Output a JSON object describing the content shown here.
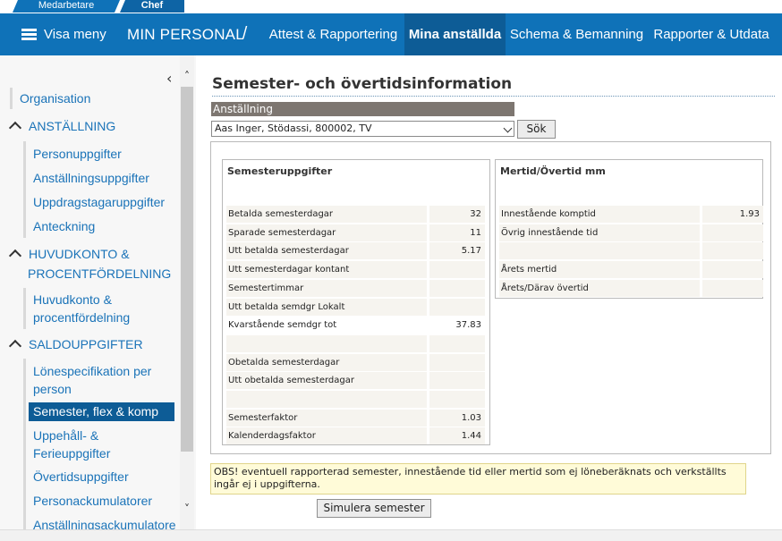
{
  "role_tabs": {
    "medarbetare": "Medarbetare",
    "chef": "Chef"
  },
  "nav": {
    "menu_label": "Visa meny",
    "brand": "MIN PERSONAL",
    "separator": "/",
    "items": [
      "Attest & Rapportering",
      "Mina anställda",
      "Schema & Bemanning",
      "Rapporter & Utdata"
    ],
    "active_item": "Mina anställda"
  },
  "sidebar": {
    "organisation": "Organisation",
    "anstallning": {
      "title": "ANSTÄLLNING",
      "items": [
        "Personuppgifter",
        "Anställningsuppgifter",
        "Uppdragstagaruppgifter",
        "Anteckning"
      ]
    },
    "huvudkonto": {
      "title_line1": "HUVUDKONTO &",
      "title_line2": "PROCENTFÖRDELNING",
      "item_line1": "Huvudkonto &",
      "item_line2": "procentfördelning"
    },
    "saldo": {
      "title": "SALDOUPPGIFTER",
      "lonespec_line1": "Lönespecifikation per",
      "lonespec_line2": "person",
      "selected": "Semester, flex & komp",
      "uppehall_line1": "Uppehåll- &",
      "uppehall_line2": "Ferieuppgifter",
      "overtid": "Övertidsuppgifter",
      "personack": "Personackumulatorer",
      "anstack": "Anställningsackumulatorer"
    }
  },
  "page": {
    "title": "Semester- och övertidsinformation",
    "employee_label": "Anställning",
    "employee_selected": "Aas Inger, Stödassi, 800002, TV",
    "search_button": "Sök",
    "simulate_button": "Simulera semester",
    "notice": "OBS! eventuell rapporterad semester, innestående tid eller mertid som ej löneberäknats och verkställts ingår ej i uppgifterna."
  },
  "semester": {
    "heading": "Semesteruppgifter",
    "rows": [
      {
        "label": "Betalda semesterdagar",
        "value": "32"
      },
      {
        "label": "Sparade semesterdagar",
        "value": "11"
      },
      {
        "label": "Utt betalda semesterdagar",
        "value": "5.17"
      },
      {
        "label": "Utt semesterdagar kontant",
        "value": ""
      },
      {
        "label": "Semestertimmar",
        "value": ""
      },
      {
        "label": "Utt betalda semdgr Lokalt",
        "value": ""
      },
      {
        "label": "Kvarstående semdgr tot",
        "value": "37.83"
      },
      {
        "label": "",
        "value": ""
      },
      {
        "label": "Obetalda semesterdagar",
        "value": ""
      },
      {
        "label": "Utt obetalda semesterdagar",
        "value": ""
      },
      {
        "label": "",
        "value": ""
      },
      {
        "label": "Semesterfaktor",
        "value": "1.03"
      },
      {
        "label": "Kalenderdagsfaktor",
        "value": "1.44"
      }
    ]
  },
  "mertid": {
    "heading": "Mertid/Övertid mm",
    "rows": [
      {
        "label": "Innestående komptid",
        "value": "1.93"
      },
      {
        "label": "Övrig innestående tid",
        "value": ""
      },
      {
        "label": "",
        "value": ""
      },
      {
        "label": "Årets mertid",
        "value": ""
      },
      {
        "label": "Årets/Därav övertid",
        "value": ""
      }
    ]
  }
}
